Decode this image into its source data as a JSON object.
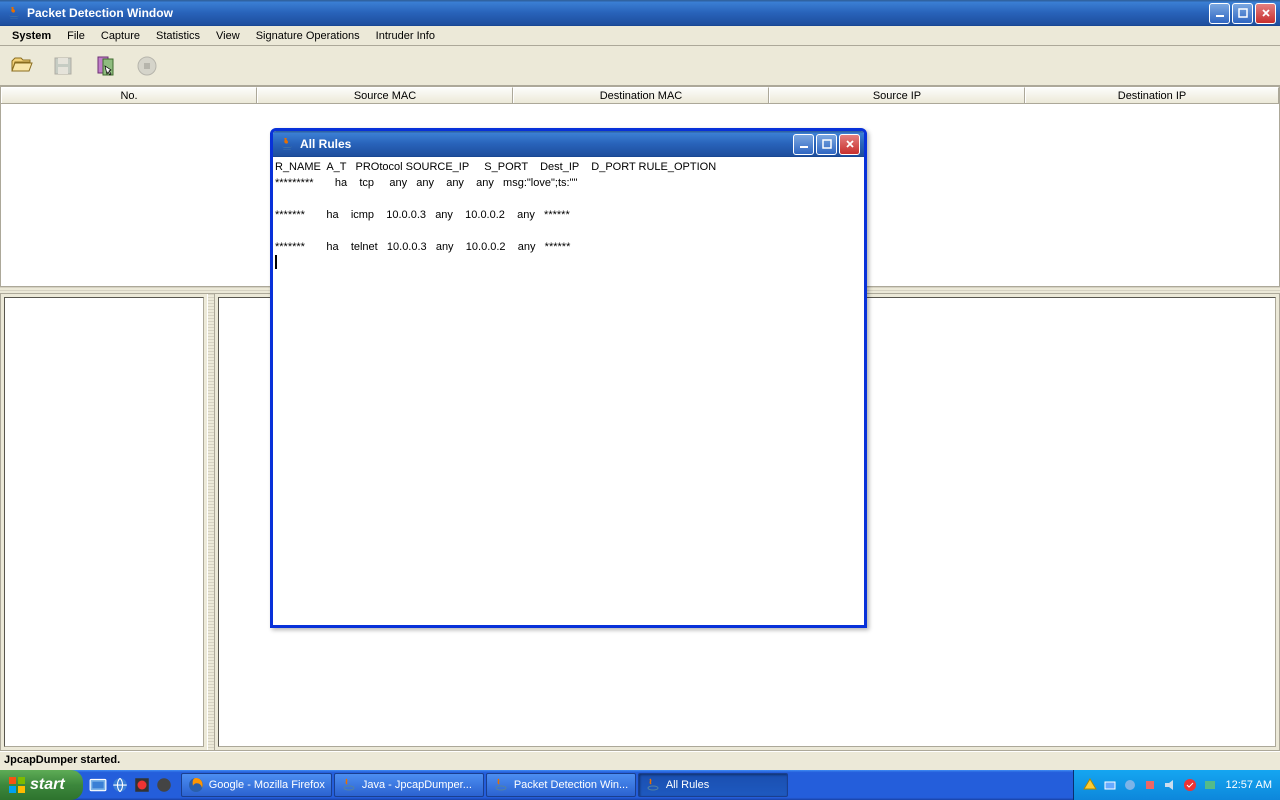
{
  "main_window": {
    "title": "Packet Detection Window"
  },
  "menubar": {
    "items": [
      "System",
      "File",
      "Capture",
      "Statistics",
      "View",
      "Signature Operations",
      "Intruder Info"
    ]
  },
  "table_columns": {
    "c0": "No.",
    "c1": "Source MAC",
    "c2": "Destination MAC",
    "c3": "Source IP",
    "c4": "Destination IP"
  },
  "statusbar": {
    "text": "JpcapDumper started."
  },
  "dialog": {
    "title": "All Rules",
    "header": "R_NAME  A_T   PROtocol SOURCE_IP     S_PORT    Dest_IP    D_PORT RULE_OPTION",
    "row1": "*********       ha    tcp     any   any    any    any   msg:\"love\";ts:\"\"",
    "row2": "",
    "row3": "*******       ha    icmp    10.0.0.3   any    10.0.0.2    any   ******",
    "row4": "",
    "row5": "*******       ha    telnet   10.0.0.3   any    10.0.0.2    any   ******"
  },
  "taskbar": {
    "start": "start",
    "items": {
      "i0": "Google - Mozilla Firefox",
      "i1": "Java - JpcapDumper...",
      "i2": "Packet Detection Win...",
      "i3": "All Rules"
    },
    "clock": "12:57 AM"
  }
}
